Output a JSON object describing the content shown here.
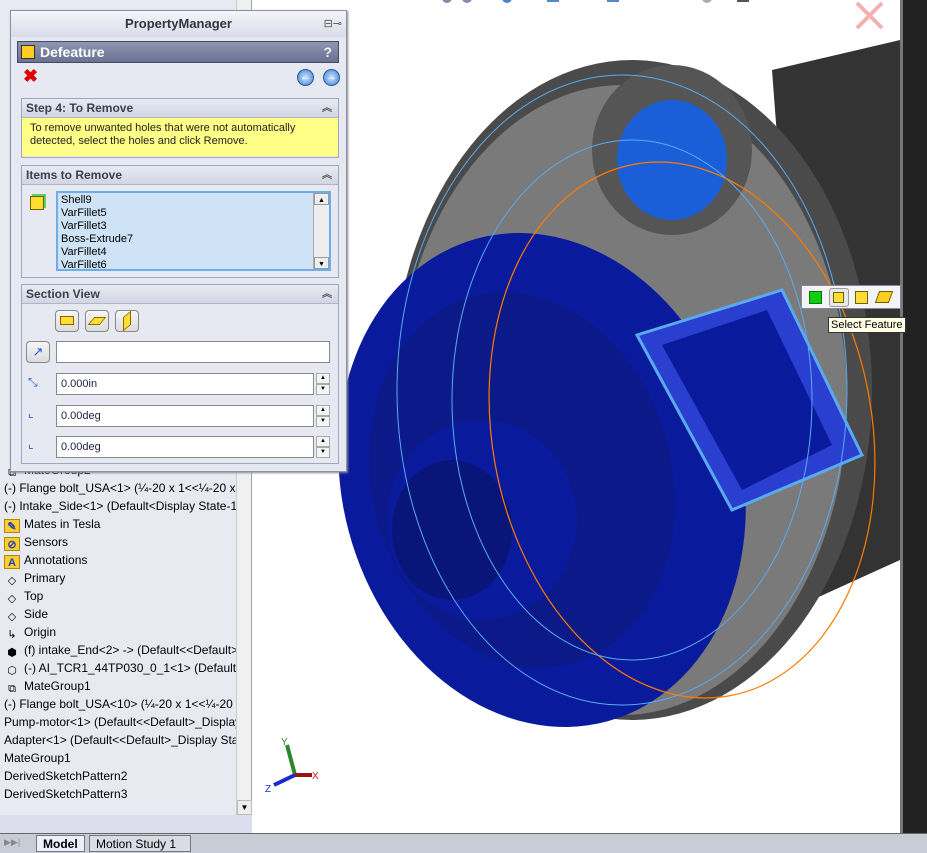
{
  "property_manager": {
    "title": "PropertyManager",
    "feature_name": "Defeature",
    "help_label": "?",
    "step_group": {
      "title": "Step 4: To Remove",
      "message": "To remove unwanted holes that were not automatically detected, select the holes and click Remove."
    },
    "items_group": {
      "title": "Items to Remove",
      "items": [
        "Shell9",
        "VarFillet5",
        "VarFillet3",
        "Boss-Extrude7",
        "VarFillet4",
        "VarFillet6"
      ]
    },
    "section_group": {
      "title": "Section View",
      "distance": "0.000in",
      "angle_x": "0.00deg",
      "angle_y": "0.00deg",
      "reference_value": ""
    }
  },
  "tree": {
    "items": [
      {
        "label": "MateGroup2",
        "icon": "mategroup-icon"
      },
      {
        "label": "(-) Flange bolt_USA<1> (¼-20 x 1<<¼-20 x",
        "icon": ""
      },
      {
        "label": "(-) Intake_Side<1> (Default<Display State-1>",
        "icon": ""
      },
      {
        "label": "Mates in Tesla",
        "icon": "mates-folder-icon"
      },
      {
        "label": "Sensors",
        "icon": "sensors-folder-icon"
      },
      {
        "label": "Annotations",
        "icon": "annotations-folder-icon"
      },
      {
        "label": "Primary",
        "icon": "plane-icon"
      },
      {
        "label": "Top",
        "icon": "plane-icon"
      },
      {
        "label": "Side",
        "icon": "plane-icon"
      },
      {
        "label": "Origin",
        "icon": "origin-icon"
      },
      {
        "label": "(f) intake_End<2> -> (Default<<Default>",
        "icon": "part-icon"
      },
      {
        "label": "(-) AI_TCR1_44TP030_0_1<1> (Default<<",
        "icon": "part-outline-icon"
      },
      {
        "label": "MateGroup1",
        "icon": "mategroup-icon"
      },
      {
        "label": "(-) Flange bolt_USA<10> (¼-20 x 1<<¼-20 x",
        "icon": ""
      },
      {
        "label": "Pump-motor<1> (Default<<Default>_Display",
        "icon": ""
      },
      {
        "label": "Adapter<1> (Default<<Default>_Display Sta",
        "icon": ""
      },
      {
        "label": "MateGroup1",
        "icon": ""
      },
      {
        "label": "DerivedSketchPattern2",
        "icon": ""
      },
      {
        "label": "DerivedSketchPattern3",
        "icon": ""
      }
    ]
  },
  "bottom_tabs": [
    "Model",
    "Motion Study 1"
  ],
  "context_toolbar": {
    "tooltip": "Select Feature"
  },
  "triad": {
    "x": "X",
    "y": "Y",
    "z": "Z"
  },
  "colors": {
    "model_blue": "#0a1a9c",
    "edge_blue": "#5aaaf0",
    "accent_orange": "#ff7a00",
    "hint_yellow": "#ffff88"
  }
}
